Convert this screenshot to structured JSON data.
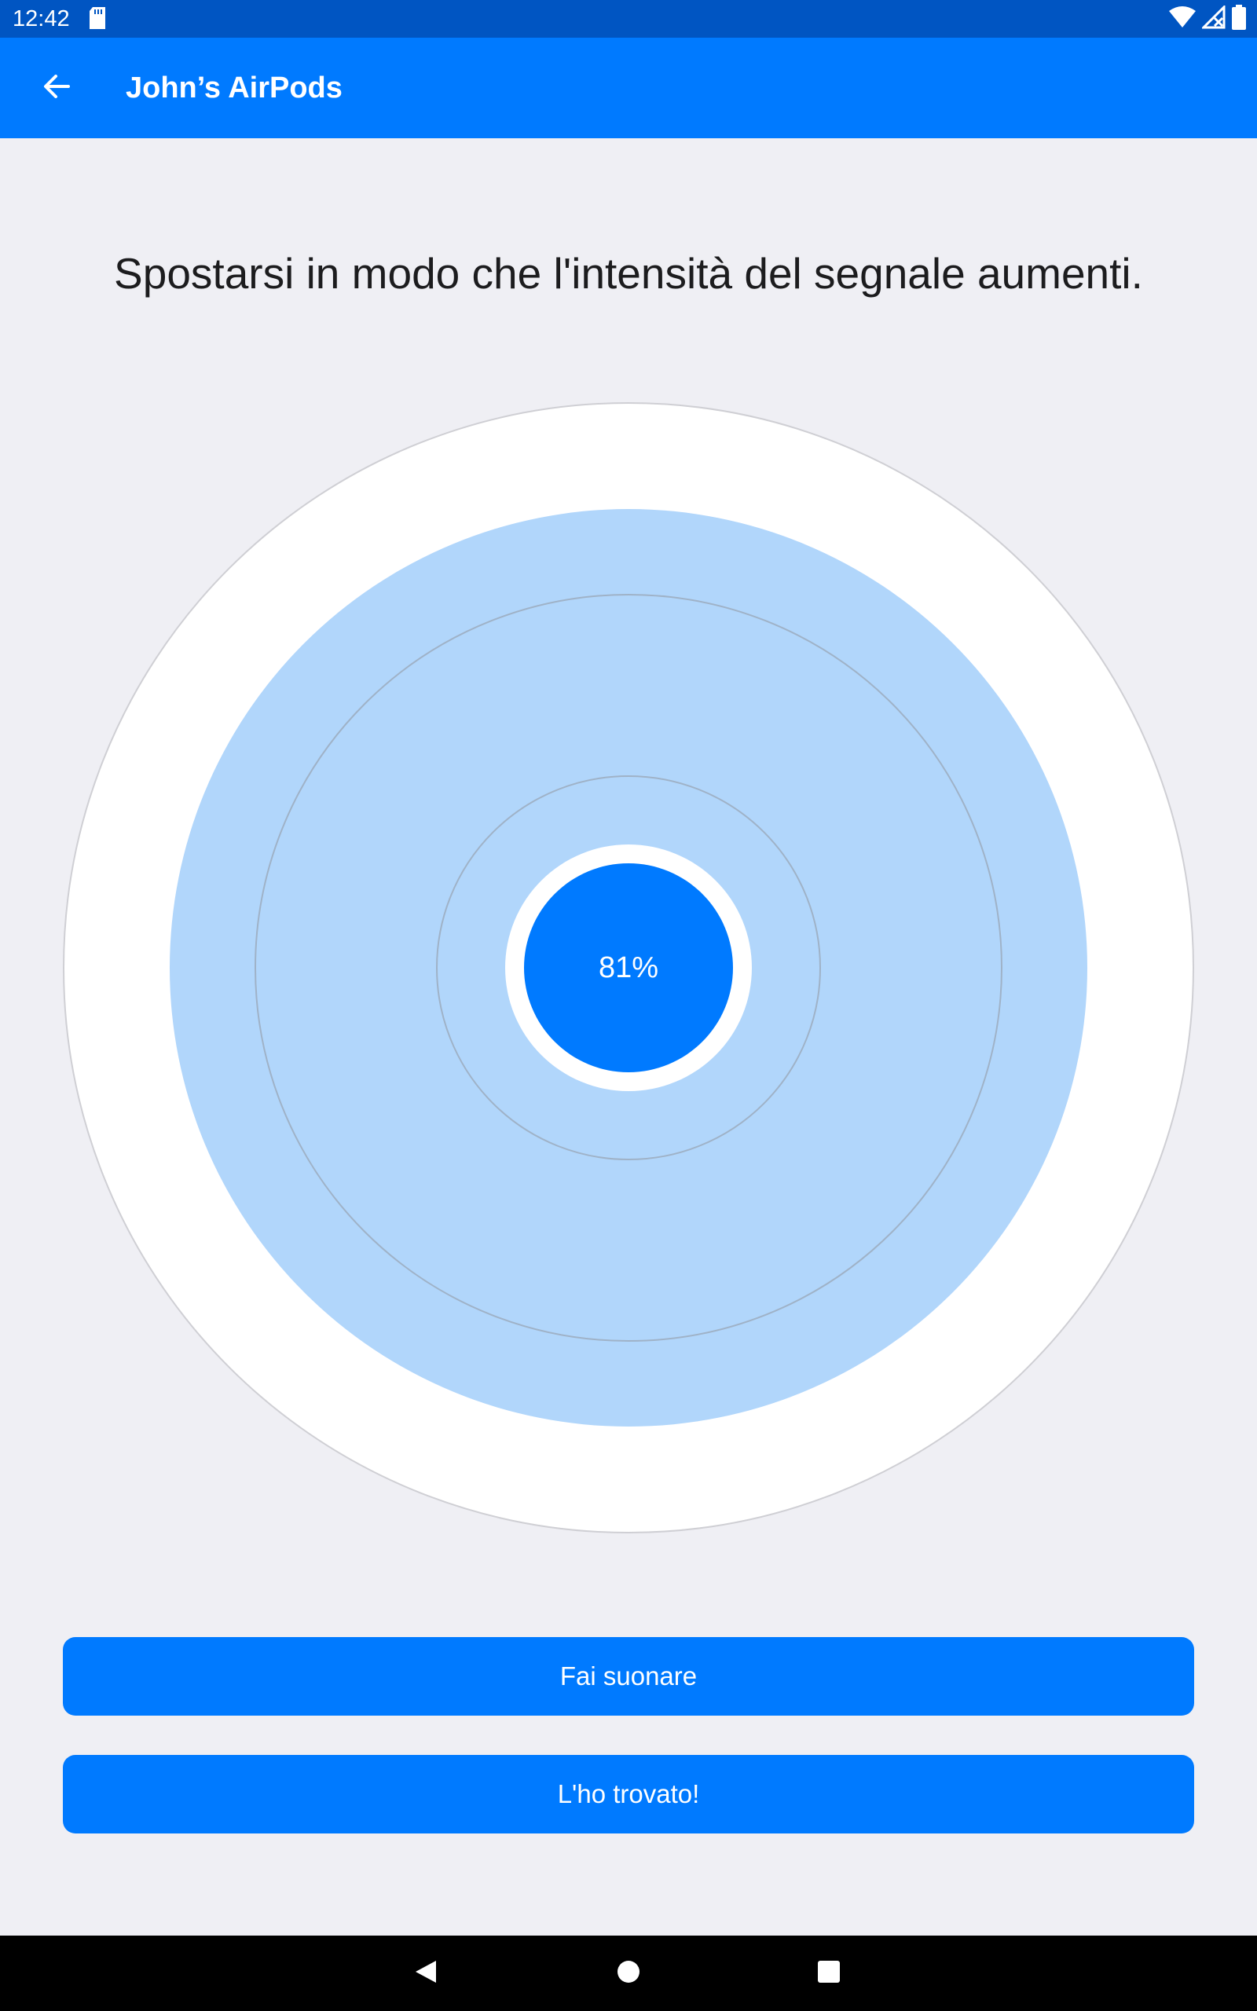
{
  "status_bar": {
    "time": "12:42",
    "icons": [
      "sd-card-icon",
      "wifi-icon",
      "cellular-no-signal-icon",
      "battery-icon"
    ]
  },
  "app_bar": {
    "title": "John’s AirPods",
    "back_icon": "arrow-left-icon"
  },
  "main": {
    "instruction": "Spostarsi in modo che l'intensità del segnale aumenti.",
    "signal": {
      "percent_label": "81%",
      "strength": 0.81
    }
  },
  "buttons": {
    "ring_label": "Fai suonare",
    "found_label": "L'ho trovato!"
  },
  "nav_bar": {
    "icons": [
      "back-triangle-icon",
      "home-circle-icon",
      "recents-square-icon"
    ]
  },
  "colors": {
    "accent": "#007aff",
    "status_bar": "#0055c2",
    "signal_fill": "#b1d6fb",
    "background": "#efeff4"
  }
}
